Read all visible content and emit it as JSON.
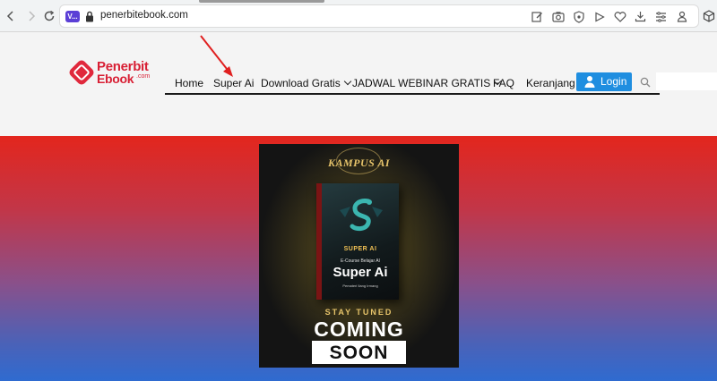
{
  "browser": {
    "url": "penerbitebook.com",
    "site_badge": "V..."
  },
  "logo": {
    "line1": "Penerbit",
    "line2": "Ebook",
    "suffix": ".com"
  },
  "nav": {
    "items": [
      "Home",
      "Super Ai",
      "Download Gratis",
      "JADWAL WEBINAR GRATIS",
      "FAQ",
      "Keranjang"
    ],
    "login_label": "Login"
  },
  "promo": {
    "brand": "KAMPUS AI",
    "book_title": "SUPER AI",
    "book_subtitle": "E-Course Belajar AI",
    "book_main": "Super Ai",
    "book_author": "Pemateri Ilang Irmang",
    "stay_tuned": "STAY TUNED",
    "coming": "COMING",
    "soon": "SOON"
  },
  "colors": {
    "brand_red": "#d81f34",
    "login_blue": "#1f8ee0",
    "hero_top": "#e3261d",
    "hero_bottom": "#2f6bd0",
    "annotation_arrow": "#e02020"
  },
  "icons": [
    "back-arrow-icon",
    "forward-arrow-icon",
    "reload-icon",
    "lock-icon",
    "edit-icon",
    "camera-icon",
    "shield-icon",
    "play-icon",
    "heart-icon",
    "download-icon",
    "settings-icon",
    "profile-icon",
    "extension-icon",
    "user-icon",
    "search-icon"
  ]
}
